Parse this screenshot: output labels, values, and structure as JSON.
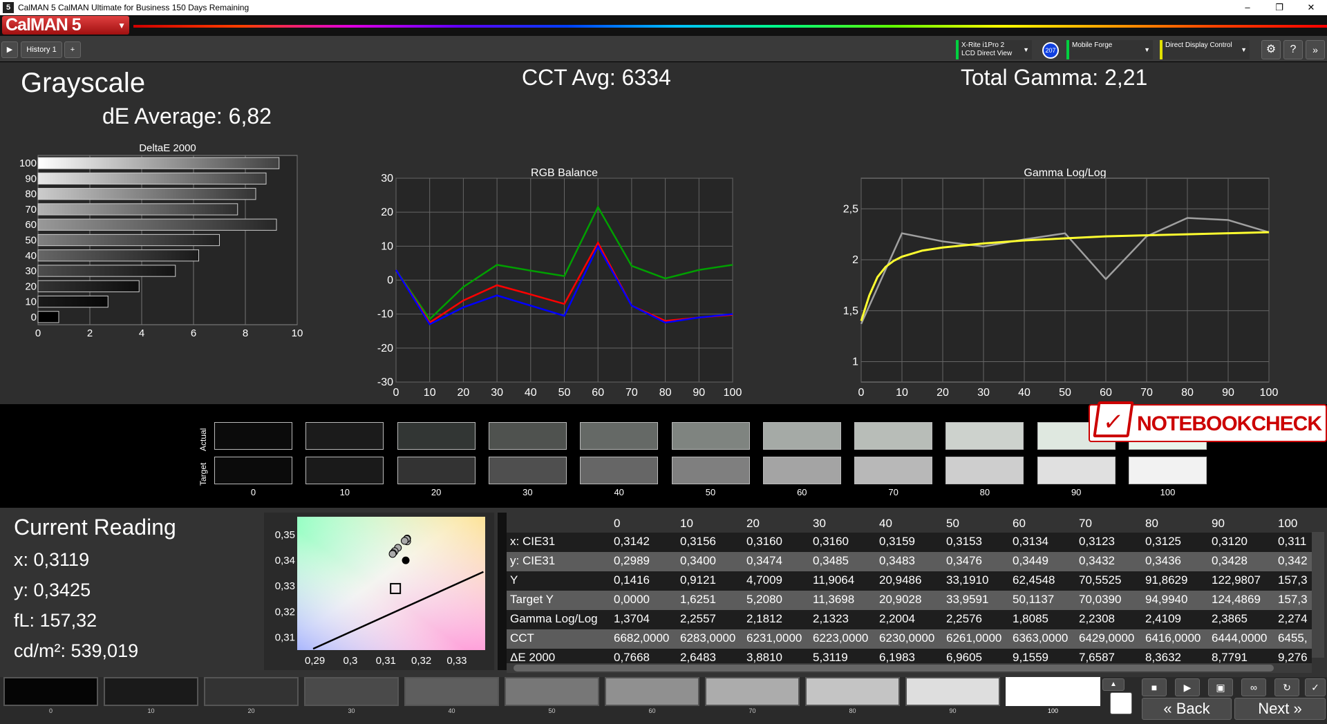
{
  "window": {
    "title": "CalMAN 5 CalMAN Ultimate for Business 150 Days Remaining",
    "app_icon": "5",
    "minimize": "–",
    "maximize": "❐",
    "close": "✕"
  },
  "logo": {
    "text": "CalMAN 5"
  },
  "tabs": [
    {
      "label": "History 1"
    }
  ],
  "devices": [
    {
      "line1": "X-Rite i1Pro 2",
      "line2": "LCD Direct View",
      "color": "#00d040"
    },
    {
      "line1": "Mobile Forge",
      "line2": "",
      "color": "#00d040"
    },
    {
      "line1": "Direct Display Control",
      "line2": "",
      "color": "#e0e000"
    }
  ],
  "device_badge": "207",
  "headings": {
    "grayscale": "Grayscale",
    "de_average": "dE Average: 6,82",
    "cct_avg": "CCT Avg: 6334",
    "total_gamma": "Total Gamma: 2,21"
  },
  "deltae_chart": {
    "title": "DeltaE 2000",
    "categories": [
      "0",
      "10",
      "20",
      "30",
      "40",
      "50",
      "60",
      "70",
      "80",
      "90",
      "100"
    ],
    "values": [
      0.8,
      2.7,
      3.9,
      5.3,
      6.2,
      7.0,
      9.2,
      7.7,
      8.4,
      8.8,
      9.3
    ],
    "xticks": [
      "0",
      "2",
      "4",
      "6",
      "8",
      "10"
    ],
    "xlim": [
      0,
      10
    ]
  },
  "rgb_chart": {
    "title": "RGB Balance",
    "x": [
      0,
      10,
      20,
      30,
      40,
      50,
      60,
      70,
      80,
      90,
      100
    ],
    "xticks": [
      "0",
      "10",
      "20",
      "30",
      "40",
      "50",
      "60",
      "70",
      "80",
      "90",
      "100"
    ],
    "yticks": [
      "30",
      "20",
      "10",
      "0",
      "-10",
      "-20",
      "-30"
    ],
    "ylim": [
      -30,
      30
    ],
    "series": [
      {
        "color": "#00a000",
        "values": [
          3,
          -11.5,
          -2,
          4.5,
          2.8,
          1.2,
          21.5,
          4.2,
          0.5,
          3,
          4.5
        ]
      },
      {
        "color": "#ff0000",
        "values": [
          3,
          -12.5,
          -6,
          -1.5,
          -4.2,
          -7,
          11,
          -7.5,
          -12,
          -11,
          -10.2
        ]
      },
      {
        "color": "#0000ff",
        "values": [
          3,
          -13,
          -8,
          -4.5,
          -7.5,
          -10.5,
          10,
          -7.5,
          -12.5,
          -11,
          -10
        ]
      }
    ]
  },
  "gamma_chart": {
    "title": "Gamma Log/Log",
    "x": [
      0,
      10,
      20,
      30,
      40,
      50,
      60,
      70,
      80,
      90,
      100
    ],
    "xticks": [
      "0",
      "10",
      "20",
      "30",
      "40",
      "50",
      "60",
      "70",
      "80",
      "90",
      "100"
    ],
    "yticks": [
      "2,5",
      "2",
      "1,5",
      "1"
    ],
    "ylim": [
      0.8,
      2.8
    ],
    "measured": [
      1.37,
      2.26,
      2.18,
      2.13,
      2.2,
      2.26,
      1.81,
      2.23,
      2.41,
      2.39,
      2.27
    ],
    "target_x": [
      0,
      2,
      4,
      6,
      8,
      10,
      15,
      20,
      30,
      40,
      50,
      60,
      70,
      80,
      90,
      100
    ],
    "target": [
      1.4,
      1.65,
      1.83,
      1.93,
      1.99,
      2.03,
      2.09,
      2.12,
      2.16,
      2.19,
      2.21,
      2.23,
      2.24,
      2.25,
      2.26,
      2.27
    ],
    "measured_color": "#a0a0a0",
    "target_color": "#ffff30"
  },
  "swatches": {
    "actual_label": "Actual",
    "target_label": "Target",
    "labels": [
      "0",
      "10",
      "20",
      "30",
      "40",
      "50",
      "60",
      "70",
      "80",
      "90",
      "100"
    ],
    "actual_colors": [
      "#0b0b0b",
      "#1b1b1b",
      "#323634",
      "#4f524f",
      "#656966",
      "#7f8480",
      "#a5aaa6",
      "#b8bdb8",
      "#cdd2cd",
      "#dfe8e0",
      "#eaf5ec"
    ],
    "target_colors": [
      "#0b0b0b",
      "#1a1a1a",
      "#333333",
      "#4f4f4f",
      "#666666",
      "#7f7f7f",
      "#a4a4a4",
      "#b8b8b8",
      "#cecece",
      "#e0e0e0",
      "#f2f2f2"
    ]
  },
  "watermark": {
    "text": "NOTEBOOKCHECK"
  },
  "current_reading": {
    "title": "Current Reading",
    "x": "x: 0,3119",
    "y": "y: 0,3425",
    "fl": "fL: 157,32",
    "cdm2": "cd/m²: 539,019"
  },
  "cie_chart": {
    "xticks": [
      "0,29",
      "0,3",
      "0,31",
      "0,32",
      "0,33"
    ],
    "yticks": [
      "0,35",
      "0,34",
      "0,33",
      "0,32",
      "0,31"
    ],
    "xlim": [
      0.285,
      0.338
    ],
    "ylim": [
      0.305,
      0.357
    ],
    "points_x": [
      0.3142,
      0.3156,
      0.316,
      0.316,
      0.3159,
      0.3153,
      0.3134,
      0.3123,
      0.3125,
      0.312,
      0.3119
    ],
    "points_y": [
      0.2989,
      0.34,
      0.3474,
      0.3485,
      0.3483,
      0.3476,
      0.3449,
      0.3432,
      0.3436,
      0.3428,
      0.3425
    ],
    "target": {
      "x": 0.3127,
      "y": 0.329
    }
  },
  "table": {
    "columns": [
      "",
      "0",
      "10",
      "20",
      "30",
      "40",
      "50",
      "60",
      "70",
      "80",
      "90",
      "100"
    ],
    "rows": [
      {
        "label": "x: CIE31",
        "cells": [
          "0,3142",
          "0,3156",
          "0,3160",
          "0,3160",
          "0,3159",
          "0,3153",
          "0,3134",
          "0,3123",
          "0,3125",
          "0,3120",
          "0,311"
        ]
      },
      {
        "label": "y: CIE31",
        "cells": [
          "0,2989",
          "0,3400",
          "0,3474",
          "0,3485",
          "0,3483",
          "0,3476",
          "0,3449",
          "0,3432",
          "0,3436",
          "0,3428",
          "0,342"
        ]
      },
      {
        "label": "Y",
        "cells": [
          "0,1416",
          "0,9121",
          "4,7009",
          "11,9064",
          "20,9486",
          "33,1910",
          "62,4548",
          "70,5525",
          "91,8629",
          "122,9807",
          "157,3"
        ]
      },
      {
        "label": "Target Y",
        "cells": [
          "0,0000",
          "1,6251",
          "5,2080",
          "11,3698",
          "20,9028",
          "33,9591",
          "50,1137",
          "70,0390",
          "94,9940",
          "124,4869",
          "157,3"
        ]
      },
      {
        "label": "Gamma Log/Log",
        "cells": [
          "1,3704",
          "2,2557",
          "2,1812",
          "2,1323",
          "2,2004",
          "2,2576",
          "1,8085",
          "2,2308",
          "2,4109",
          "2,3865",
          "2,274"
        ]
      },
      {
        "label": "CCT",
        "cells": [
          "6682,0000",
          "6283,0000",
          "6231,0000",
          "6223,0000",
          "6230,0000",
          "6261,0000",
          "6363,0000",
          "6429,0000",
          "6416,0000",
          "6444,0000",
          "6455,"
        ]
      },
      {
        "label": "ΔE 2000",
        "cells": [
          "0,7668",
          "2,6483",
          "3,8810",
          "5,3119",
          "6,1983",
          "6,9605",
          "9,1559",
          "7,6587",
          "8,3632",
          "8,7791",
          "9,276"
        ]
      }
    ]
  },
  "footer": {
    "labels": [
      "0",
      "10",
      "20",
      "30",
      "40",
      "50",
      "60",
      "70",
      "80",
      "90",
      "100"
    ],
    "colors": [
      "#050505",
      "#1a1a1a",
      "#333333",
      "#4a4a4a",
      "#5e5e5e",
      "#777777",
      "#909090",
      "#acacac",
      "#c4c4c4",
      "#dedede",
      "#ffffff"
    ],
    "back": "Back",
    "next": "Next"
  }
}
